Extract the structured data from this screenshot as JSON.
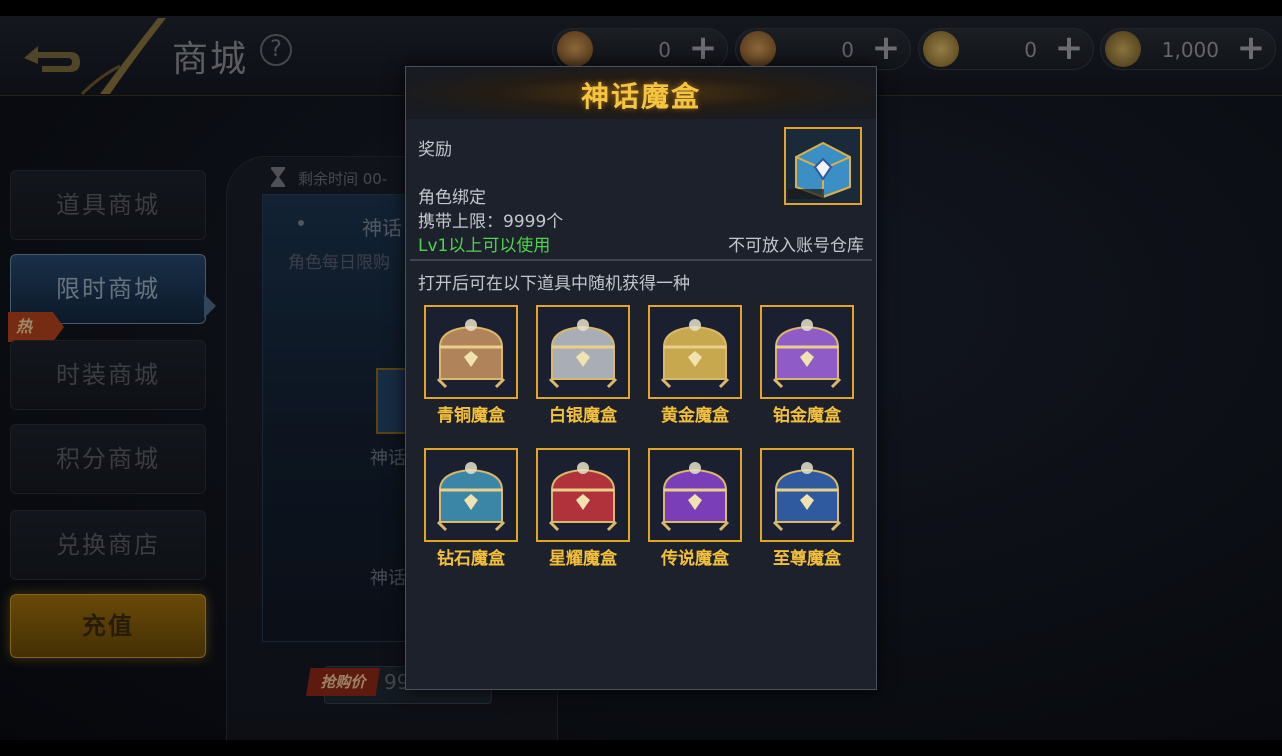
{
  "header": {
    "title": "商城",
    "help_icon": "question-icon",
    "currencies": [
      {
        "icon": "scroll-ticket-icon",
        "value": "0",
        "color": "#b8843a"
      },
      {
        "icon": "scroll-lock-icon",
        "value": "0",
        "color": "#b8843a"
      },
      {
        "icon": "coin-icon",
        "value": "0",
        "color": "#c2a04a"
      },
      {
        "icon": "coin-lock-icon",
        "value": "1,000",
        "color": "#a58a3e"
      }
    ]
  },
  "sidebar": {
    "items": [
      {
        "label": "道具商城"
      },
      {
        "label": "限时商城"
      },
      {
        "label": "时装商城"
      },
      {
        "label": "积分商城"
      },
      {
        "label": "兑换商店"
      },
      {
        "label": "充值"
      }
    ],
    "hot_tag": "热"
  },
  "shop": {
    "timer_label": "剩余时间 00-",
    "card_name": "神话",
    "card_sub": "角色每日限购",
    "card_name2": "神话",
    "card_name3": "神话",
    "price_tag": "抢购价",
    "price_value": "99"
  },
  "popup": {
    "title": "神话魔盒",
    "reward_label": "奖励",
    "bind_label": "角色绑定",
    "limit_label": "携带上限：9999个",
    "level_label": "Lv1以上可以使用",
    "nostore_label": "不可放入账号仓库",
    "random_label": "打开后可在以下道具中随机获得一种",
    "items": [
      {
        "label": "青铜魔盒",
        "color": "#b0835a"
      },
      {
        "label": "白银魔盒",
        "color": "#a9aeb6"
      },
      {
        "label": "黄金魔盒",
        "color": "#c7a84e"
      },
      {
        "label": "铂金魔盒",
        "color": "#8f5cc7"
      },
      {
        "label": "钻石魔盒",
        "color": "#3b86a6"
      },
      {
        "label": "星耀魔盒",
        "color": "#b1323a"
      },
      {
        "label": "传说魔盒",
        "color": "#7a3fb8"
      },
      {
        "label": "至尊魔盒",
        "color": "#2f5aa0"
      }
    ]
  }
}
